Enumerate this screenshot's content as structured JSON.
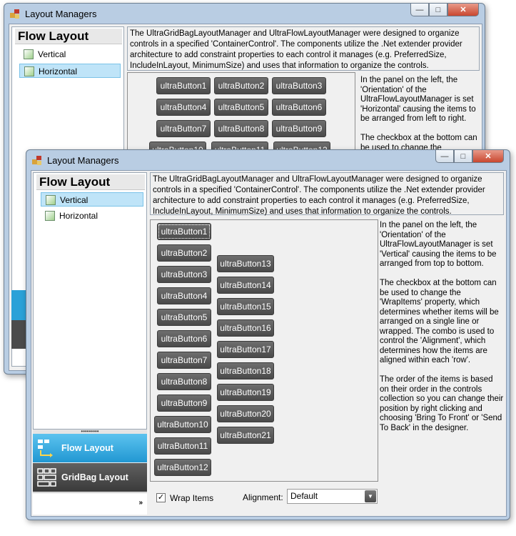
{
  "back_window": {
    "title": "Layout Managers",
    "nav_header": "Flow Layout",
    "nav_items": [
      "Vertical",
      "Horizontal"
    ],
    "description": "The UltraGridBagLayoutManager and UltraFlowLayoutManager were designed to organize controls in a specified 'ContainerControl'. The components utilize the .Net extender provider architecture to add constraint properties to each control it manages (e.g. PreferredSize, IncludeInLayout, MinimumSize) and uses that information to organize the controls.",
    "buttons": [
      "ultraButton1",
      "ultraButton2",
      "ultraButton3",
      "ultraButton4",
      "ultraButton5",
      "ultraButton6",
      "ultraButton7",
      "ultraButton8",
      "ultraButton9",
      "ultraButton10",
      "ultraButton11",
      "ultraButton12"
    ],
    "side_text": "In the panel on the left, the 'Orientation' of the UltraFlowLayoutManager is set 'Horizontal' causing the items to be arranged from left to right.\n\nThe checkbox at the bottom can be used to change the"
  },
  "front_window": {
    "title": "Layout Managers",
    "nav_header": "Flow Layout",
    "nav_items": [
      "Vertical",
      "Horizontal"
    ],
    "description": "The UltraGridBagLayoutManager and UltraFlowLayoutManager were designed to organize controls in a specified 'ContainerControl'. The components utilize the .Net extender provider architecture to add constraint properties to each control it manages (e.g. PreferredSize, IncludeInLayout, MinimumSize) and uses that information to organize the controls.",
    "buttons_col1": [
      "ultraButton1",
      "ultraButton2",
      "ultraButton3",
      "ultraButton4",
      "ultraButton5",
      "ultraButton6",
      "ultraButton7",
      "ultraButton8",
      "ultraButton9",
      "ultraButton10",
      "ultraButton11",
      "ultraButton12"
    ],
    "buttons_col2": [
      "ultraButton13",
      "ultraButton14",
      "ultraButton15",
      "ultraButton16",
      "ultraButton17",
      "ultraButton18",
      "ultraButton19",
      "ultraButton20",
      "ultraButton21"
    ],
    "side_text": "In the panel on the left, the 'Orientation' of the UltraFlowLayoutManager is set 'Vertical' causing the items to be arranged from top to bottom.\n\nThe checkbox at the bottom can be used to change the 'WrapItems' property, which determines whether items will be arranged on a single line or wrapped. The combo is used to control the 'Alignment', which determines how the items are aligned within each 'row'.\n\nThe order of the items is based on their order in the controls collection so you can change their position by right clicking and choosing 'Bring To Front' or 'Send To Back' in the designer.",
    "outlook_groups": [
      {
        "label": "Flow Layout",
        "icon": "flow-layout-icon"
      },
      {
        "label": "GridBag Layout",
        "icon": "gridbag-layout-icon"
      }
    ],
    "wrap_items_label": "Wrap Items",
    "wrap_items_checked": true,
    "alignment_label": "Alignment:",
    "alignment_value": "Default"
  },
  "colors": {
    "title_glass": "#b9cde3",
    "selection": "#bfe4f8",
    "outlook_selected": "#2aa1d8",
    "outlook_normal": "#4b4b4b",
    "button_dark": "#5a5a5a"
  }
}
